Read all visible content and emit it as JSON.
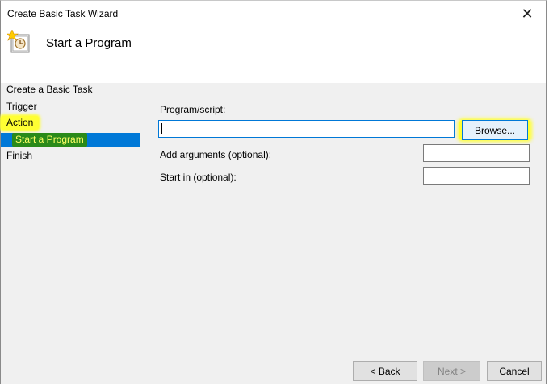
{
  "window": {
    "title": "Create Basic Task Wizard",
    "close_glyph": "✕"
  },
  "header": {
    "title": "Start a Program",
    "icon": "task-scheduler-icon"
  },
  "steps": {
    "create": "Create a Basic Task",
    "trigger": "Trigger",
    "action": "Action",
    "current": "Start a Program",
    "finish": "Finish"
  },
  "form": {
    "program_label": "Program/script:",
    "program_value": "",
    "browse_label": "Browse...",
    "args_label": "Add arguments (optional):",
    "args_value": "",
    "startin_label": "Start in (optional):",
    "startin_value": ""
  },
  "footer": {
    "back_label": "< Back",
    "next_label": "Next >",
    "cancel_label": "Cancel"
  },
  "colors": {
    "selection": "#0078d7",
    "highlight": "#ffff33",
    "dialog_bg": "#f0f0f0"
  }
}
